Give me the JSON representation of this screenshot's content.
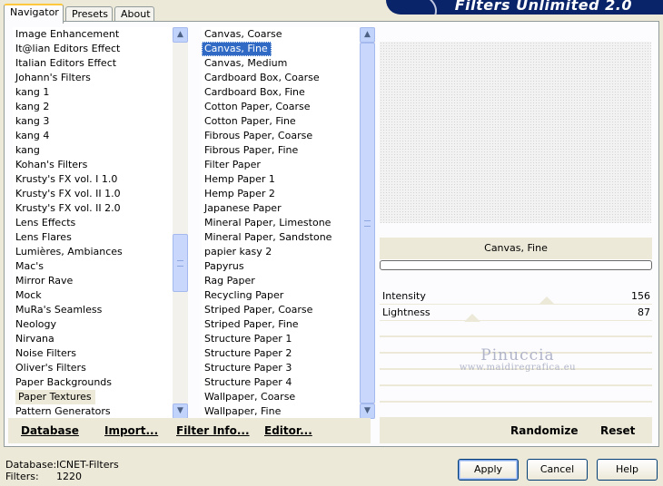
{
  "window": {
    "title": "Filters Unlimited 2.0"
  },
  "tabs": [
    {
      "label": "Navigator",
      "active": true
    },
    {
      "label": "Presets",
      "active": false
    },
    {
      "label": "About",
      "active": false
    }
  ],
  "categories": {
    "items": [
      "Image Enhancement",
      "It@lian Editors Effect",
      "Italian Editors Effect",
      "Johann's Filters",
      "kang 1",
      "kang 2",
      "kang 3",
      "kang 4",
      "kang",
      "Kohan's Filters",
      "Krusty's FX vol. I 1.0",
      "Krusty's FX vol. II 1.0",
      "Krusty's FX vol. II 2.0",
      "Lens Effects",
      "Lens Flares",
      "Lumières, Ambiances",
      "Mac's",
      "Mirror Rave",
      "Mock",
      "MuRa's Seamless",
      "Neology",
      "Nirvana",
      "Noise Filters",
      "Oliver's Filters",
      "Paper Backgrounds",
      "Paper Textures",
      "Pattern Generators"
    ],
    "highlighted_index": 25
  },
  "filters": {
    "items": [
      "Canvas, Coarse",
      "Canvas, Fine",
      "Canvas, Medium",
      "Cardboard Box, Coarse",
      "Cardboard Box, Fine",
      "Cotton Paper, Coarse",
      "Cotton Paper, Fine",
      "Fibrous Paper, Coarse",
      "Fibrous Paper, Fine",
      "Filter Paper",
      "Hemp Paper 1",
      "Hemp Paper 2",
      "Japanese Paper",
      "Mineral Paper, Limestone",
      "Mineral Paper, Sandstone",
      "papier kasy 2",
      "Papyrus",
      "Rag Paper",
      "Recycling Paper",
      "Striped Paper, Coarse",
      "Striped Paper, Fine",
      "Structure Paper 1",
      "Structure Paper 2",
      "Structure Paper 3",
      "Structure Paper 4",
      "Wallpaper, Coarse",
      "Wallpaper, Fine"
    ],
    "selected_index": 1
  },
  "preview": {
    "filter_name": "Canvas, Fine",
    "progress": 0
  },
  "sliders": [
    {
      "label": "Intensity",
      "value": "156",
      "fraction": 0.612
    },
    {
      "label": "Lightness",
      "value": "87",
      "fraction": 0.341
    }
  ],
  "watermark": {
    "line1": "Pinuccia",
    "line2": "www.maidiregrafica.eu"
  },
  "left_buttons": {
    "database": "Database",
    "import": "Import...",
    "filter_info": "Filter Info...",
    "editor": "Editor..."
  },
  "right_buttons": {
    "randomize": "Randomize",
    "reset": "Reset"
  },
  "status": {
    "database_label": "Database:",
    "database_value": "ICNET-Filters",
    "filters_label": "Filters:",
    "filters_value": "1220"
  },
  "dialog_buttons": {
    "apply": "Apply",
    "cancel": "Cancel",
    "help": "Help"
  },
  "colors": {
    "selection": "#316ac5",
    "panel": "#ece9d8",
    "banner": "#0a246a"
  }
}
